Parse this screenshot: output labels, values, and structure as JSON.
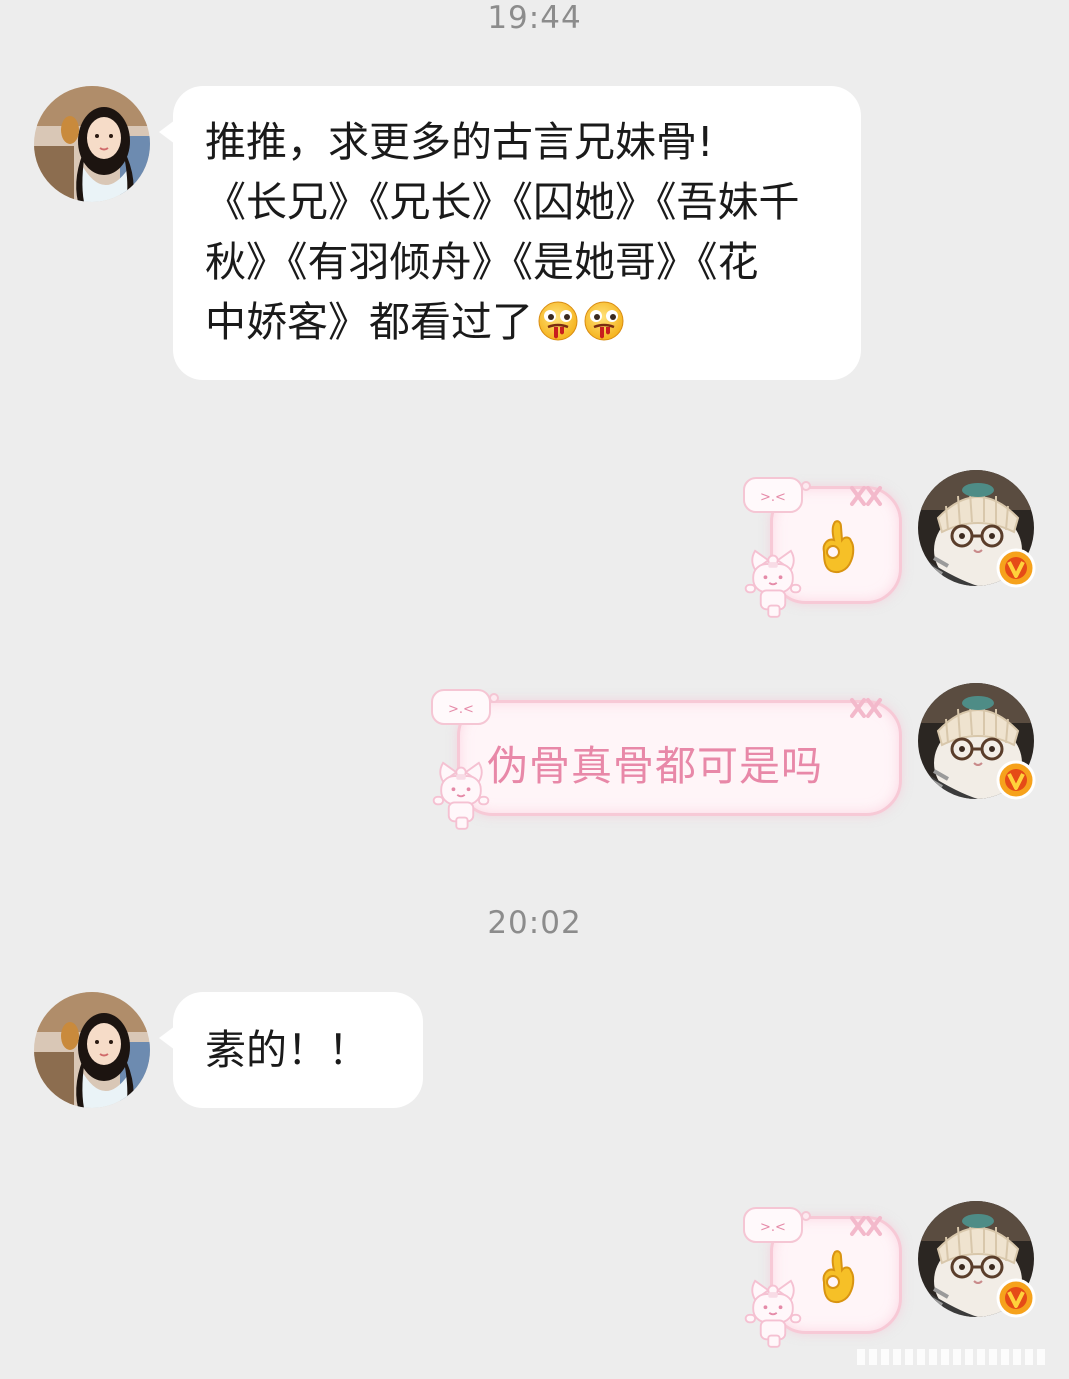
{
  "timestamps": [
    "19:44",
    "20:02"
  ],
  "messages": {
    "m1": {
      "lines": [
        "推推，求更多的古言兄妹骨!",
        "《长兄》《兄长》《囚她》《吾妹千",
        "秋》《有羽倾舟》《是她哥》《花",
        "中娇客》都看过了"
      ],
      "emoji": [
        "drooling-face-emoji",
        "drooling-face-emoji"
      ]
    },
    "m2": {
      "emoji": "ok-hand-emoji"
    },
    "m3": {
      "text": "伪骨真骨都可是吗"
    },
    "m4": {
      "text": "素的！！"
    },
    "m5": {
      "emoji": "ok-hand-emoji"
    }
  },
  "bubble_decor": {
    "tag_face": ">.<"
  },
  "colors": {
    "background": "#ededed",
    "bubble_white": "#ffffff",
    "pink_border": "#f7c9d6",
    "pink_fill": "#fff5f8",
    "pink_text": "#e888a8",
    "verified_badge": "#f6a21c"
  }
}
